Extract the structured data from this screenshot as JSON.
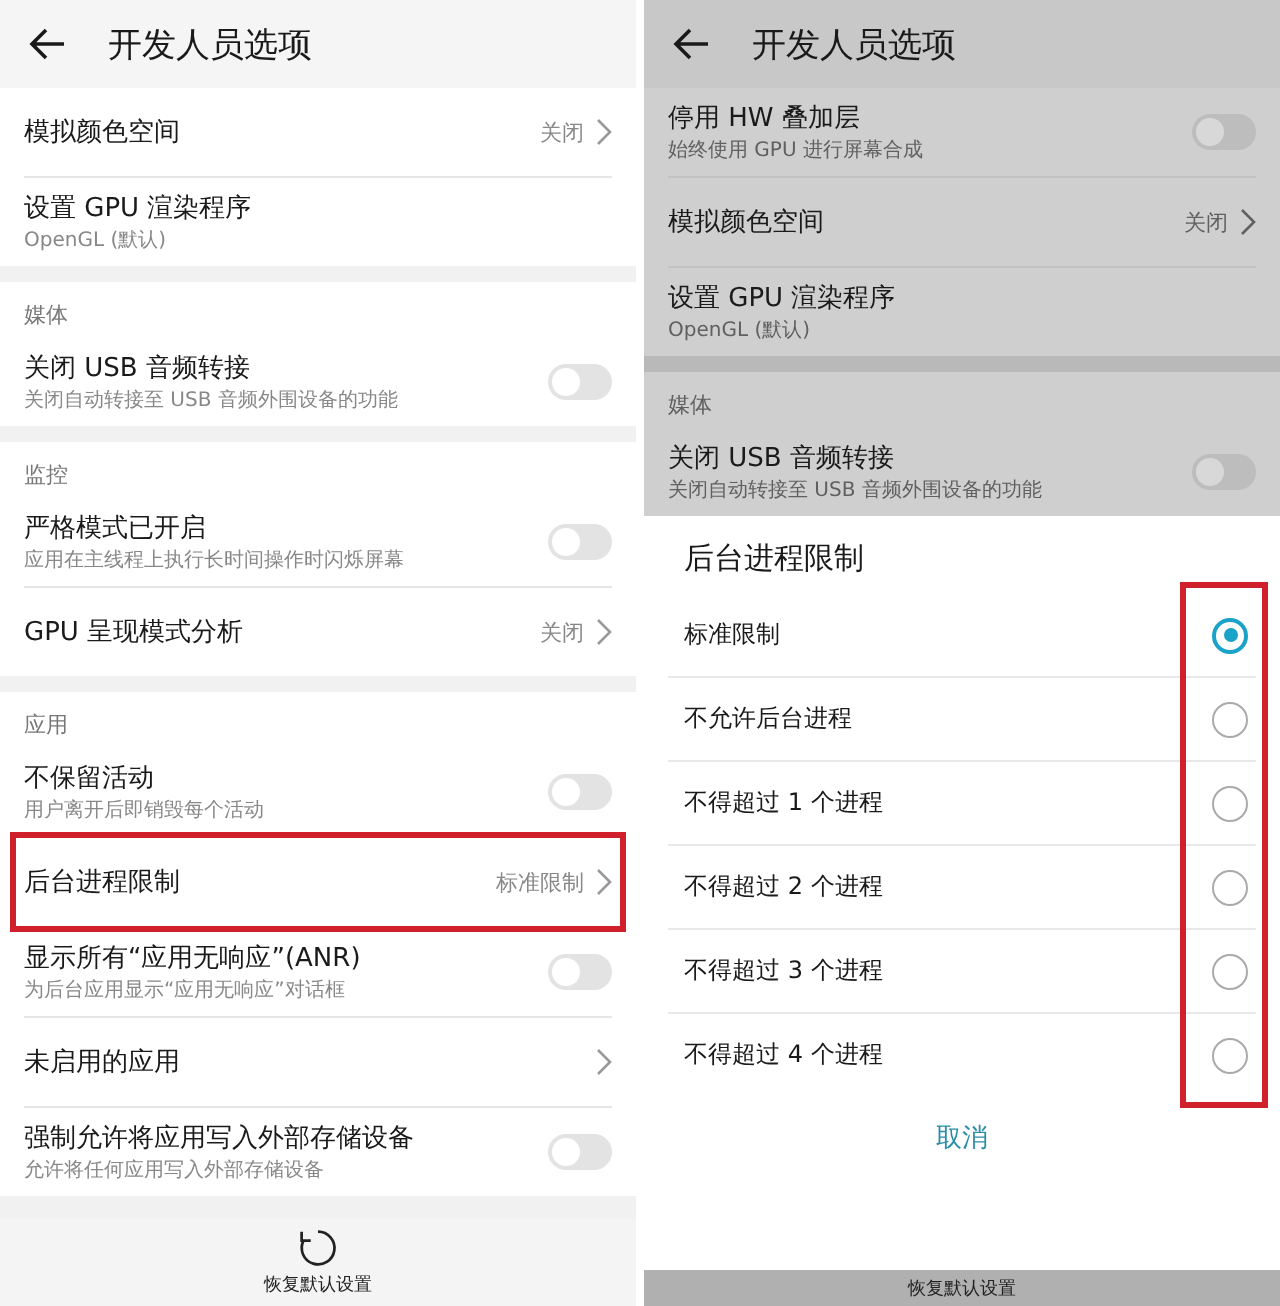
{
  "panels": [
    {
      "dimmed": false,
      "header": {
        "title": "开发人员选项"
      },
      "sections": [
        {
          "items": [
            {
              "kind": "link",
              "title": "模拟颜色空间",
              "value": "关闭",
              "highlighted": false
            },
            {
              "kind": "info",
              "title": "设置 GPU 渲染程序",
              "subtitle": "OpenGL (默认)"
            }
          ]
        },
        {
          "heading": "媒体",
          "items": [
            {
              "kind": "toggle",
              "title": "关闭 USB 音频转接",
              "subtitle": "关闭自动转接至 USB 音频外围设备的功能",
              "on": false
            }
          ]
        },
        {
          "heading": "监控",
          "items": [
            {
              "kind": "toggle",
              "title": "严格模式已开启",
              "subtitle": "应用在主线程上执行长时间操作时闪烁屏幕",
              "on": false
            },
            {
              "kind": "link",
              "title": "GPU 呈现模式分析",
              "value": "关闭",
              "highlighted": false
            }
          ]
        },
        {
          "heading": "应用",
          "items": [
            {
              "kind": "toggle",
              "title": "不保留活动",
              "subtitle": "用户离开后即销毁每个活动",
              "on": false
            },
            {
              "kind": "link",
              "title": "后台进程限制",
              "value": "标准限制",
              "highlighted": true
            },
            {
              "kind": "toggle",
              "title": "显示所有“应用无响应”(ANR)",
              "subtitle": "为后台应用显示“应用无响应”对话框",
              "on": false
            },
            {
              "kind": "link",
              "title": "未启用的应用",
              "highlighted": false
            },
            {
              "kind": "toggle",
              "title": "强制允许将应用写入外部存储设备",
              "subtitle": "允许将任何应用写入外部存储设备",
              "on": false
            }
          ]
        }
      ],
      "footer": {
        "kind": "full",
        "label": "恢复默认设置"
      }
    },
    {
      "dimmed": true,
      "header": {
        "title": "开发人员选项"
      },
      "sections": [
        {
          "items": [
            {
              "kind": "toggle",
              "title": "停用 HW 叠加层",
              "subtitle": "始终使用 GPU 进行屏幕合成",
              "on": false
            },
            {
              "kind": "link",
              "title": "模拟颜色空间",
              "value": "关闭",
              "highlighted": false
            },
            {
              "kind": "info",
              "title": "设置 GPU 渲染程序",
              "subtitle": "OpenGL (默认)"
            }
          ]
        },
        {
          "heading": "媒体",
          "items": [
            {
              "kind": "toggle",
              "title": "关闭 USB 音频转接",
              "subtitle": "关闭自动转接至 USB 音频外围设备的功能",
              "on": false
            }
          ]
        }
      ],
      "dialog": {
        "title": "后台进程限制",
        "options_highlighted": true,
        "options": [
          {
            "label": "标准限制",
            "selected": true
          },
          {
            "label": "不允许后台进程",
            "selected": false
          },
          {
            "label": "不得超过 1 个进程",
            "selected": false
          },
          {
            "label": "不得超过 2 个进程",
            "selected": false
          },
          {
            "label": "不得超过 3 个进程",
            "selected": false
          },
          {
            "label": "不得超过 4 个进程",
            "selected": false
          }
        ],
        "cancel": "取消"
      },
      "footer": {
        "kind": "collapsed",
        "label": "恢复默认设置"
      }
    }
  ]
}
